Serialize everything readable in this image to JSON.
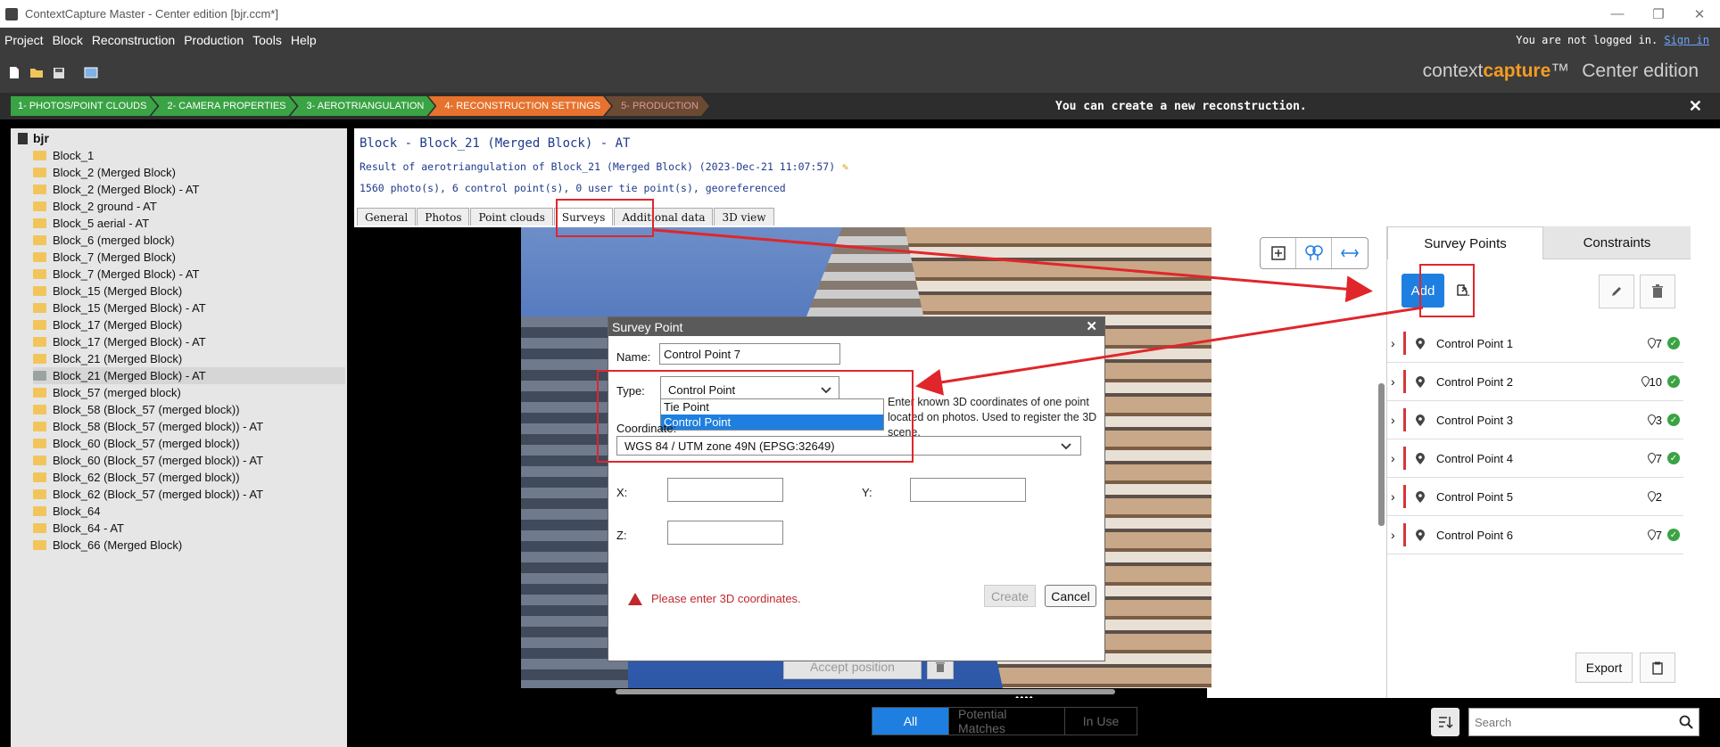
{
  "window": {
    "title": "ContextCapture Master - Center edition [bjr.ccm*]",
    "minimize": "—",
    "restore": "❐",
    "close": "✕"
  },
  "menu": {
    "items": [
      "Project",
      "Block",
      "Reconstruction",
      "Production",
      "Tools",
      "Help"
    ],
    "login_text": "You are not logged in.",
    "sign_in": "Sign in"
  },
  "brand": {
    "context": "context",
    "capture": "capture",
    "tm": "™",
    "edition": "Center edition"
  },
  "workflow": {
    "steps": [
      "1- PHOTOS/POINT CLOUDS",
      "2- CAMERA PROPERTIES",
      "3- AEROTRIANGULATION",
      "4- RECONSTRUCTION SETTINGS",
      "5- PRODUCTION"
    ],
    "message": "You can create a new reconstruction.",
    "close": "✕"
  },
  "tree": {
    "root": "bjr",
    "items": [
      "Block_1",
      "Block_2 (Merged Block)",
      "Block_2 (Merged Block) - AT",
      "Block_2 ground - AT",
      "Block_5 aerial - AT",
      "Block_6 (merged block)",
      "Block_7 (Merged Block)",
      "Block_7 (Merged Block) - AT",
      "Block_15 (Merged Block)",
      "Block_15 (Merged Block) - AT",
      "Block_17 (Merged Block)",
      "Block_17 (Merged Block) - AT",
      "Block_21 (Merged Block)",
      "Block_21 (Merged Block) - AT",
      "Block_57 (merged block)",
      "Block_58 (Block_57 (merged block))",
      "Block_58 (Block_57 (merged block)) - AT",
      "Block_60 (Block_57 (merged block))",
      "Block_60 (Block_57 (merged block)) - AT",
      "Block_62 (Block_57 (merged block))",
      "Block_62 (Block_57 (merged block)) - AT",
      "Block_64",
      "Block_64 - AT",
      "Block_66 (Merged Block)"
    ],
    "selected_index": 13
  },
  "header": {
    "title": "Block - Block_21 (Merged Block) - AT",
    "result": "Result of aerotriangulation of Block_21 (Merged Block) (2023-Dec-21 11:07:57)",
    "stats": "1560 photo(s), 6 control point(s), 0 user tie point(s), georeferenced"
  },
  "tabs": [
    "General",
    "Photos",
    "Point clouds",
    "Surveys",
    "Additional data",
    "3D view"
  ],
  "active_tab": "Surveys",
  "viewer": {
    "accept_label": "Accept position",
    "dots": "••••"
  },
  "bottom": {
    "filters": [
      "All",
      "Potential Matches",
      "In Use"
    ],
    "search_placeholder": "Search"
  },
  "right": {
    "tabs": [
      "Survey Points",
      "Constraints"
    ],
    "add_label": "Add",
    "export_label": "Export",
    "points": [
      {
        "name": "Control Point 1",
        "count": "7",
        "ok": true
      },
      {
        "name": "Control Point 2",
        "count": "10",
        "ok": true
      },
      {
        "name": "Control Point 3",
        "count": "3",
        "ok": true
      },
      {
        "name": "Control Point 4",
        "count": "7",
        "ok": true
      },
      {
        "name": "Control Point 5",
        "count": "2",
        "ok": false
      },
      {
        "name": "Control Point 6",
        "count": "7",
        "ok": true
      }
    ]
  },
  "dialog": {
    "title": "Survey Point",
    "name_label": "Name:",
    "name_value": "Control Point 7",
    "type_label": "Type:",
    "type_value": "Control Point",
    "type_options": [
      "Tie Point",
      "Control Point"
    ],
    "hint": "Enter known 3D coordinates of one point located on photos. Used to register the 3D scene.",
    "coordinate_label": "Coordinate:",
    "coordinate_value": "WGS 84 / UTM zone 49N (EPSG:32649)",
    "x_label": "X:",
    "y_label": "Y:",
    "z_label": "Z:",
    "warning": "Please enter 3D coordinates.",
    "create_label": "Create",
    "cancel_label": "Cancel",
    "close": "✕"
  },
  "colors": {
    "accent": "#1e7fe0",
    "annotation": "#e0262b",
    "step_done": "#3aa344",
    "step_current": "#e6722d"
  }
}
